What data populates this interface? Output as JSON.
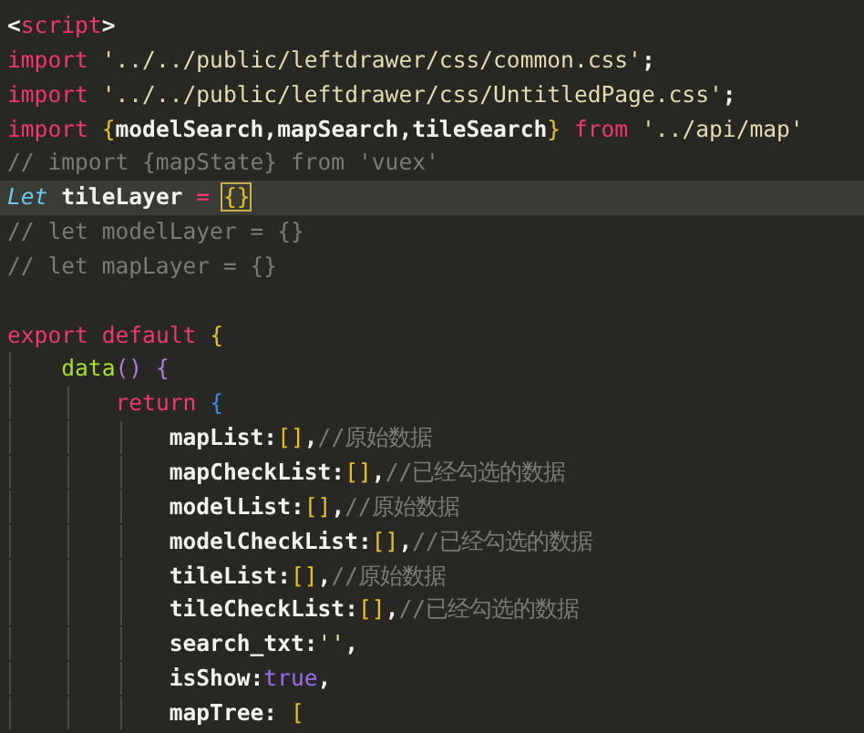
{
  "editor": {
    "lines": [
      {
        "current": false,
        "tokens": [
          {
            "text": "<",
            "kind": "punct"
          },
          {
            "text": "script",
            "kind": "tag"
          },
          {
            "text": ">",
            "kind": "punct"
          }
        ]
      },
      {
        "current": false,
        "tokens": [
          {
            "text": "import",
            "kind": "keyword"
          },
          {
            "text": " '../../public/leftdrawer/css/common.css'",
            "kind": "string"
          },
          {
            "text": ";",
            "kind": "punct"
          }
        ]
      },
      {
        "current": false,
        "tokens": [
          {
            "text": "import",
            "kind": "keyword"
          },
          {
            "text": " '../../public/leftdrawer/css/UntitledPage.css'",
            "kind": "string"
          },
          {
            "text": ";",
            "kind": "punct"
          }
        ]
      },
      {
        "current": false,
        "tokens": [
          {
            "text": "import",
            "kind": "keyword"
          },
          {
            "text": " {",
            "kind": "brace"
          },
          {
            "text": "modelSearch,mapSearch,tileSearch",
            "kind": "plain"
          },
          {
            "text": "}",
            "kind": "brace"
          },
          {
            "text": " from",
            "kind": "keyword"
          },
          {
            "text": " '../api/map'",
            "kind": "string"
          }
        ]
      },
      {
        "current": false,
        "tokens": [
          {
            "text": "// import {mapState} from 'vuex'",
            "kind": "comment"
          }
        ]
      },
      {
        "current": true,
        "tokens": [
          {
            "text": "Let",
            "kind": "storage"
          },
          {
            "text": " tileLayer",
            "kind": "plain"
          },
          {
            "text": " =",
            "kind": "operator"
          },
          {
            "text": " {}",
            "kind": "brace-match"
          }
        ]
      },
      {
        "current": false,
        "tokens": [
          {
            "text": "// let modelLayer = {}",
            "kind": "comment"
          }
        ]
      },
      {
        "current": false,
        "tokens": [
          {
            "text": "// let mapLayer = {}",
            "kind": "comment"
          }
        ]
      },
      {
        "current": false
      },
      {
        "current": false,
        "tokens": [
          {
            "text": "export",
            "kind": "keyword"
          },
          {
            "text": " default",
            "kind": "keyword"
          },
          {
            "text": " {",
            "kind": "brace"
          }
        ]
      },
      {
        "current": false,
        "tokens": [
          {
            "text": "    data",
            "kind": "function"
          },
          {
            "text": "()",
            "kind": "paren"
          },
          {
            "text": " {",
            "kind": "paren"
          }
        ]
      },
      {
        "current": false,
        "tokens": [
          {
            "text": "        return",
            "kind": "keyword"
          },
          {
            "text": " {",
            "kind": "brace-inner"
          }
        ]
      },
      {
        "current": false,
        "tokens": [
          {
            "text": "            mapList:",
            "kind": "plain"
          },
          {
            "text": "[]",
            "kind": "brace"
          },
          {
            "text": ",",
            "kind": "punct"
          },
          {
            "text": "//原始数据",
            "kind": "comment"
          }
        ]
      },
      {
        "current": false,
        "tokens": [
          {
            "text": "            mapCheckList:",
            "kind": "plain"
          },
          {
            "text": "[]",
            "kind": "brace"
          },
          {
            "text": ",",
            "kind": "punct"
          },
          {
            "text": "//已经勾选的数据",
            "kind": "comment"
          }
        ]
      },
      {
        "current": false,
        "tokens": [
          {
            "text": "            modelList:",
            "kind": "plain"
          },
          {
            "text": "[]",
            "kind": "brace"
          },
          {
            "text": ",",
            "kind": "punct"
          },
          {
            "text": "//原始数据",
            "kind": "comment"
          }
        ]
      },
      {
        "current": false,
        "tokens": [
          {
            "text": "            modelCheckList:",
            "kind": "plain"
          },
          {
            "text": "[]",
            "kind": "brace"
          },
          {
            "text": ",",
            "kind": "punct"
          },
          {
            "text": "//已经勾选的数据",
            "kind": "comment"
          }
        ]
      },
      {
        "current": false,
        "tokens": [
          {
            "text": "            tileList:",
            "kind": "plain"
          },
          {
            "text": "[]",
            "kind": "brace"
          },
          {
            "text": ",",
            "kind": "punct"
          },
          {
            "text": "//原始数据",
            "kind": "comment"
          }
        ]
      },
      {
        "current": false,
        "tokens": [
          {
            "text": "            tileCheckList:",
            "kind": "plain"
          },
          {
            "text": "[]",
            "kind": "brace"
          },
          {
            "text": ",",
            "kind": "punct"
          },
          {
            "text": "//已经勾选的数据",
            "kind": "comment"
          }
        ]
      },
      {
        "current": false,
        "tokens": [
          {
            "text": "            search_txt:",
            "kind": "plain"
          },
          {
            "text": "''",
            "kind": "string"
          },
          {
            "text": ",",
            "kind": "punct"
          }
        ]
      },
      {
        "current": false,
        "tokens": [
          {
            "text": "            isShow:",
            "kind": "plain"
          },
          {
            "text": "true",
            "kind": "boolean"
          },
          {
            "text": ",",
            "kind": "punct"
          }
        ]
      },
      {
        "current": false,
        "tokens": [
          {
            "text": "            mapTree:",
            "kind": "plain"
          },
          {
            "text": " [",
            "kind": "brace"
          }
        ]
      }
    ]
  }
}
